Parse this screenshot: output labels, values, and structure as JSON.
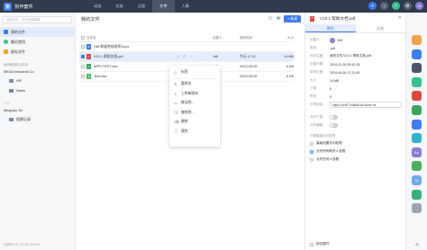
{
  "app": {
    "title": "协作套件",
    "logo": "协"
  },
  "nav": [
    {
      "label": "动态",
      "active": false
    },
    {
      "label": "任务",
      "active": false
    },
    {
      "label": "日程",
      "active": false
    },
    {
      "label": "文件",
      "active": true
    },
    {
      "label": "人事",
      "active": false
    }
  ],
  "top_right": {
    "avatar": "Je"
  },
  "sidebar": {
    "search_placeholder": "搜索文件、文件夹和同事",
    "items": [
      {
        "label": "我的文件",
        "active": true,
        "color": "#3d7bf7"
      },
      {
        "label": "最近使用",
        "active": false,
        "color": "#34c38f"
      },
      {
        "label": "星标文件",
        "active": false,
        "color": "#f5a623"
      }
    ],
    "team_section": "组织和团队文件夹",
    "org": "MEGA Industrial Co.",
    "org_folders": [
      "HR",
      "Sales"
    ],
    "personal_section": "个人",
    "person": "Mingxiao Jin",
    "person_folders": [
      "组建记录"
    ],
    "storage": "已使用 0 B / 10 GB (0.00%)"
  },
  "main": {
    "title": "我的文件",
    "new_label": "+ 新建",
    "columns": {
      "name": "文件名",
      "owner": "创建人",
      "date": "修改时间",
      "size": "大小"
    },
    "rows": [
      {
        "name": "HAF职级考核说明.docx",
        "type": "word",
        "owner": "",
        "date": "",
        "size": "",
        "selected": false,
        "checked": false
      },
      {
        "name": "V10.1 帮助文档.pdf",
        "type": "pdf",
        "owner": "Jeff",
        "date": "今天 17:11",
        "size": "14 MB",
        "selected": true,
        "checked": true
      },
      {
        "name": "WPS TEST.xlsx",
        "type": "xls",
        "owner": "Jeff",
        "date": "2023-03-09",
        "size": "6 KB",
        "selected": false,
        "checked": false
      },
      {
        "name": "Test.xlsx",
        "type": "txt",
        "owner": "Jeff",
        "date": "2023-03-09",
        "size": "6 KB",
        "selected": false,
        "checked": false
      }
    ],
    "row_ops": [
      "⇩",
      "ⓘ",
      "⋯"
    ]
  },
  "context_menu": [
    {
      "label": "标签",
      "icon": "tag-icon",
      "glyph": "◇"
    },
    {
      "label": "重命名",
      "icon": "edit-icon",
      "glyph": "✎"
    },
    {
      "label": "上传新版本",
      "icon": "upload-icon",
      "glyph": "⇧"
    },
    {
      "label": "移动到...",
      "icon": "move-icon",
      "glyph": "▭"
    },
    {
      "label": "复制到...",
      "icon": "copy-icon",
      "glyph": "❐"
    },
    {
      "label": "删除",
      "icon": "delete-icon",
      "glyph": "🗑"
    },
    {
      "label": "属性",
      "icon": "info-icon",
      "glyph": "ⓘ"
    }
  ],
  "panel": {
    "title": "V10.1 帮助文档.pdf",
    "tabs": [
      "属性",
      "历史"
    ],
    "props": [
      {
        "k": "创建人",
        "v": "Jeff"
      },
      {
        "k": "类型",
        "v": ".pdf"
      },
      {
        "k": "所在位置",
        "v": "我的文件/V10.1 帮助文档.pdf"
      },
      {
        "k": "创建日期",
        "v": "2024-01-26 09:42:26"
      },
      {
        "k": "修改日期",
        "v": "2024-04-26 17:11:45"
      },
      {
        "k": "大小",
        "v": "14 MB"
      },
      {
        "k": "下载",
        "v": "0"
      },
      {
        "k": "预览",
        "v": "0"
      }
    ],
    "share_label": "分享链接",
    "share_link": "https://h1bf774d8d61a5.share.mi",
    "allow_download": "允许下载",
    "allow_share": "允许编辑",
    "access_section": "外部链接访问权限",
    "radios": [
      {
        "label": "高级设置访问权限",
        "on": false
      },
      {
        "label": "允许所有联系人查看",
        "on": true
      },
      {
        "label": "允许任何人查看",
        "on": false
      }
    ],
    "footer": "锁住展开"
  },
  "rail": [
    {
      "label": "",
      "color": "#f0a24a"
    },
    {
      "label": "",
      "color": "#3d7bf7"
    },
    {
      "label": "",
      "color": "#4a5568"
    },
    {
      "label": "",
      "color": "#34c38f"
    },
    {
      "label": "",
      "color": "#e0473f"
    },
    {
      "label": "",
      "color": "#36a85e"
    },
    {
      "label": "",
      "color": "#3d7bf7"
    },
    {
      "label": "",
      "color": "#2db6c8"
    },
    {
      "label": "Bo",
      "color": "#8c7bd8"
    },
    {
      "label": "",
      "color": "#4aaf5e"
    },
    {
      "label": "Ta",
      "color": "#6fa8f0"
    },
    {
      "label": "",
      "color": "#35b07d"
    },
    {
      "label": "",
      "color": "#9aa3b2"
    }
  ],
  "rail_footer": "AI"
}
